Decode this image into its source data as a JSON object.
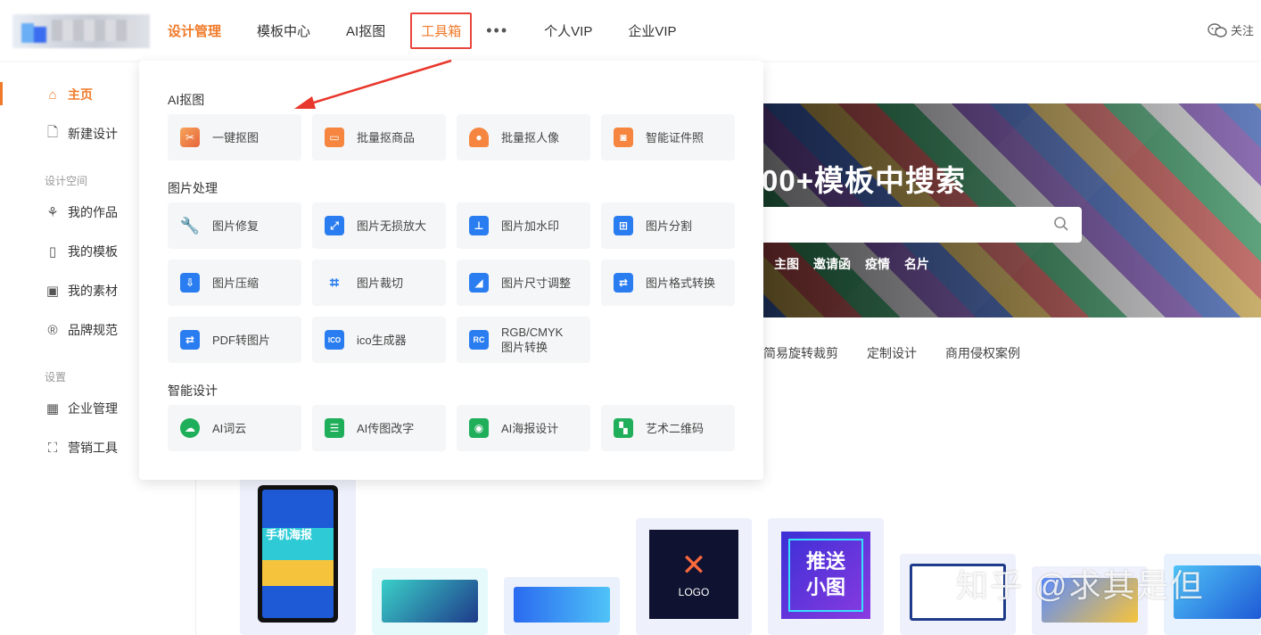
{
  "header": {
    "nav": [
      "设计管理",
      "模板中心",
      "AI抠图",
      "工具箱",
      "个人VIP",
      "企业VIP"
    ],
    "more": "•••",
    "follow": "关注"
  },
  "sidebar": {
    "home": "主页",
    "new_design": "新建设计",
    "section_space": "设计空间",
    "my_works": "我的作品",
    "my_templates": "我的模板",
    "my_assets": "我的素材",
    "brand": "品牌规范",
    "section_settings": "设置",
    "enterprise": "企业管理",
    "marketing": "营销工具"
  },
  "banner": {
    "title": "00+模板中搜索",
    "tags": [
      "主图",
      "邀请函",
      "疫情",
      "名片"
    ]
  },
  "subnav": [
    "简易旋转裁剪",
    "定制设计",
    "商用侵权案例"
  ],
  "cards": {
    "phone_text": "手机海报",
    "logo_text": "LOGO",
    "push_line1": "推送",
    "push_line2": "小图",
    "watermark": "知乎 @求其是但"
  },
  "dropdown": {
    "sections": {
      "ai_cutout": "AI抠图",
      "image_processing": "图片处理",
      "smart_design": "智能设计"
    },
    "ai_cutout": [
      "一键抠图",
      "批量抠商品",
      "批量抠人像",
      "智能证件照"
    ],
    "image_processing": [
      "图片修复",
      "图片无损放大",
      "图片加水印",
      "图片分割",
      "图片压缩",
      "图片裁切",
      "图片尺寸调整",
      "图片格式转换",
      "PDF转图片",
      "ico生成器"
    ],
    "rgb_line1": "RGB/CMYK",
    "rgb_line2": "图片转换",
    "smart_design": [
      "AI词云",
      "AI传图改字",
      "AI海报设计",
      "艺术二维码"
    ]
  },
  "colors": {
    "accent": "#f07a2a",
    "highlight_box": "#e8453c"
  }
}
